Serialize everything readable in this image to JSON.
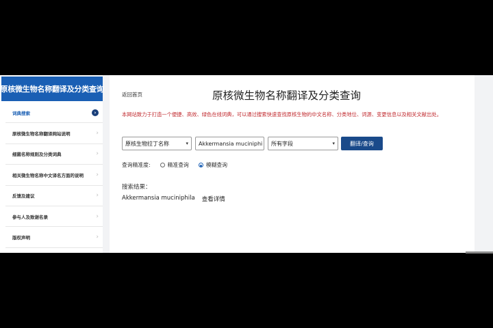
{
  "sidebar": {
    "title": "原核微生物名称翻译及分类查询",
    "items": [
      {
        "label": "词典搜索",
        "active": true
      },
      {
        "label": "原核微生物名称翻译网站说明"
      },
      {
        "label": "细菌名称规则及分类词典"
      },
      {
        "label": "相关微生物名称中文译名方面的说明"
      },
      {
        "label": "反馈及建议"
      },
      {
        "label": "参与人及致谢名录"
      },
      {
        "label": "版权声明"
      }
    ]
  },
  "main": {
    "back_link": "返回首页",
    "title": "原核微生物名称翻译及分类查询",
    "description": "本网站致力于打造一个便捷、高效、绿色在线词典，可以通过搜索快速查找原核生物的中文名称、分类地位、词源、变更信息以及相关文献出处。",
    "search": {
      "language_select": "原核生物拉丁名称",
      "name_input": "Akkermansia muciniphi",
      "field_select": "所有字段",
      "translate_button": "翻译/查询"
    },
    "precision": {
      "label": "查询精准度:",
      "options": [
        {
          "label": "精准查询",
          "selected": false
        },
        {
          "label": "模糊查询",
          "selected": true
        }
      ]
    },
    "results": {
      "label": "搜索结果：",
      "items": [
        {
          "name": "Akkermansia muciniphila",
          "action": "查看详情"
        }
      ]
    }
  },
  "colors": {
    "brand_blue": "#1a5fb4",
    "button_blue": "#1a4a8a",
    "description_red": "#c0282d"
  }
}
